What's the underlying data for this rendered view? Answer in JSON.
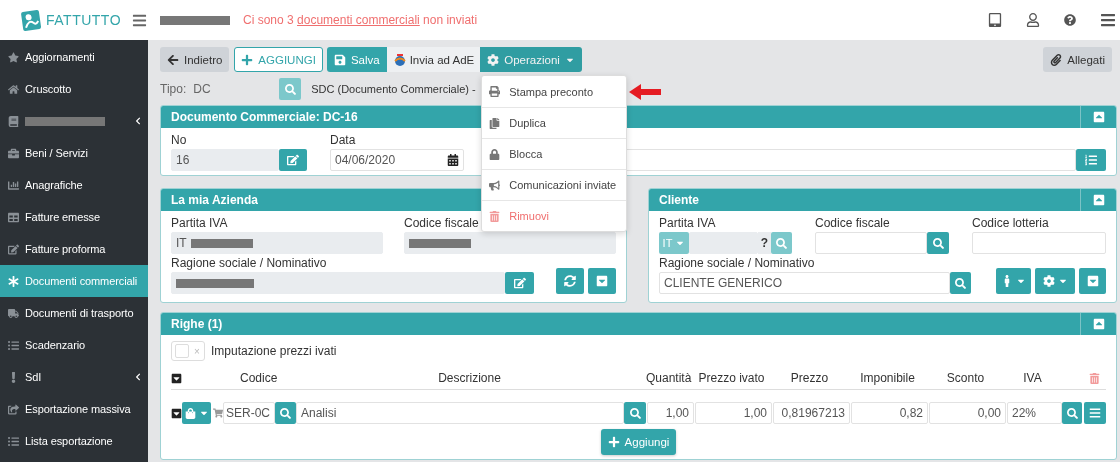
{
  "header": {
    "logo": "FATTUTTO",
    "notice": {
      "before": "Ci sono 3 ",
      "link": "documenti commerciali",
      "after": " non inviati"
    }
  },
  "sidebar": {
    "items": [
      {
        "label": "Aggiornamenti",
        "selected": false,
        "submenu": false
      },
      {
        "label": "Cruscotto",
        "selected": false,
        "submenu": false
      },
      {
        "kind": "redacted",
        "selected": false,
        "submenu": true
      },
      {
        "label": "Beni / Servizi",
        "selected": false,
        "submenu": false
      },
      {
        "label": "Anagrafiche",
        "selected": false,
        "submenu": false
      },
      {
        "label": "Fatture emesse",
        "selected": false,
        "submenu": false
      },
      {
        "label": "Fatture proforma",
        "selected": false,
        "submenu": false
      },
      {
        "label": "Documenti commerciali",
        "selected": true,
        "submenu": false
      },
      {
        "label": "Documenti di trasporto",
        "selected": false,
        "submenu": false
      },
      {
        "label": "Scadenzario",
        "selected": false,
        "submenu": false
      },
      {
        "label": "SdI",
        "selected": false,
        "submenu": true
      },
      {
        "label": "Esportazione massiva",
        "selected": false,
        "submenu": false
      },
      {
        "label": "Lista esportazione",
        "selected": false,
        "submenu": false
      }
    ]
  },
  "toolbar": {
    "back": "Indietro",
    "add": "AGGIUNGI",
    "save": "Salva",
    "send": "Invia ad AdE",
    "operations": {
      "label": "Operazioni",
      "expanded": true
    },
    "attachments": "Allegati"
  },
  "operations_menu": [
    {
      "label": "Stampa preconto",
      "kind": "normal"
    },
    {
      "label": "Duplica",
      "kind": "normal"
    },
    {
      "label": "Blocca",
      "kind": "normal"
    },
    {
      "label": "Comunicazioni inviate",
      "kind": "normal"
    },
    {
      "label": "Rimuovi",
      "kind": "danger"
    }
  ],
  "type_row": {
    "label": "Tipo:",
    "value": "DC",
    "description": "SDC (Documento Commerciale) -"
  },
  "document_panel": {
    "title": "Documento Commerciale: DC-16",
    "number_label": "No",
    "number": "16",
    "date_label": "Data",
    "date": "04/06/2020"
  },
  "company_panel": {
    "title": "La mia Azienda",
    "vat_label": "Partita IVA",
    "vat_prefix": "IT",
    "tax_code_label": "Codice fiscale",
    "name_label": "Ragione sociale / Nominativo"
  },
  "customer_panel": {
    "title": "Cliente",
    "vat_label": "Partita IVA",
    "vat_country": "IT",
    "vat_check": "?",
    "tax_code_label": "Codice fiscale",
    "lottery_label": "Codice lotteria",
    "name_label": "Ragione sociale / Nominativo",
    "name": "CLIENTE GENERICO"
  },
  "lines_panel": {
    "title": "Righe (1)",
    "vat_inclusive": {
      "label": "Imputazione prezzi ivati",
      "checked": false,
      "off_mark": "×"
    },
    "columns": [
      "Codice",
      "Descrizione",
      "Quantità",
      "Prezzo ivato",
      "Prezzo",
      "Imponibile",
      "Sconto",
      "IVA"
    ],
    "rows": [
      {
        "code": "SER-0C",
        "description": "Analisi",
        "quantity": "1,00",
        "gross_price": "1,00",
        "price": "0,81967213",
        "taxable": "0,82",
        "discount": "0,00",
        "vat": "22%"
      }
    ],
    "add": "Aggiungi"
  }
}
